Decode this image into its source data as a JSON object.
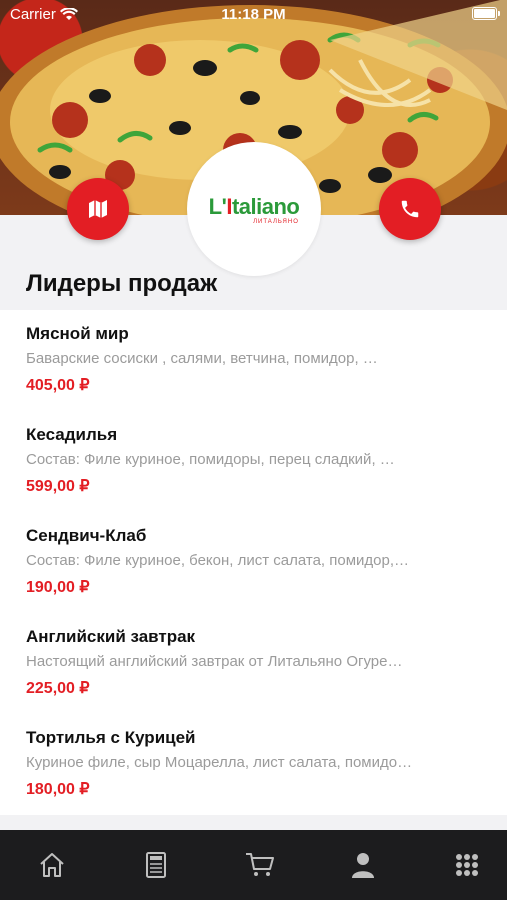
{
  "status_bar": {
    "carrier": "Carrier",
    "time": "11:18 PM"
  },
  "hero": {
    "logo_main_prefix": "L'",
    "logo_main_rest": "taliano",
    "logo_subtitle": "ЛИТАЛЬЯНО",
    "map_icon": "map-icon",
    "call_icon": "phone-icon"
  },
  "section": {
    "title": "Лидеры продаж"
  },
  "products": [
    {
      "name": "Мясной мир",
      "description": "Баварские сосиски , салями, ветчина, помидор, …",
      "price": "405,00 ₽"
    },
    {
      "name": "Кесадилья",
      "description": "Состав: Филе куриное, помидоры, перец сладкий, …",
      "price": "599,00 ₽"
    },
    {
      "name": "Сендвич-Клаб",
      "description": "Состав: Филе куриное, бекон, лист салата, помидор,…",
      "price": "190,00 ₽"
    },
    {
      "name": "Английский завтрак",
      "description": "Настоящий английский завтрак от Литальяно  Огуре…",
      "price": "225,00 ₽"
    },
    {
      "name": "Тортилья с Курицей",
      "description": "Куриное филе, сыр Моцарелла, лист салата, помидо…",
      "price": "180,00 ₽"
    }
  ],
  "tab_bar": {
    "tabs": [
      "home-icon",
      "menu-icon",
      "cart-icon",
      "profile-icon",
      "grid-icon"
    ]
  },
  "colors": {
    "accent": "#e31e24",
    "green": "#2b9a3a",
    "tab_bar_bg": "#1c1c1e",
    "muted_text": "#9b9b9b"
  }
}
